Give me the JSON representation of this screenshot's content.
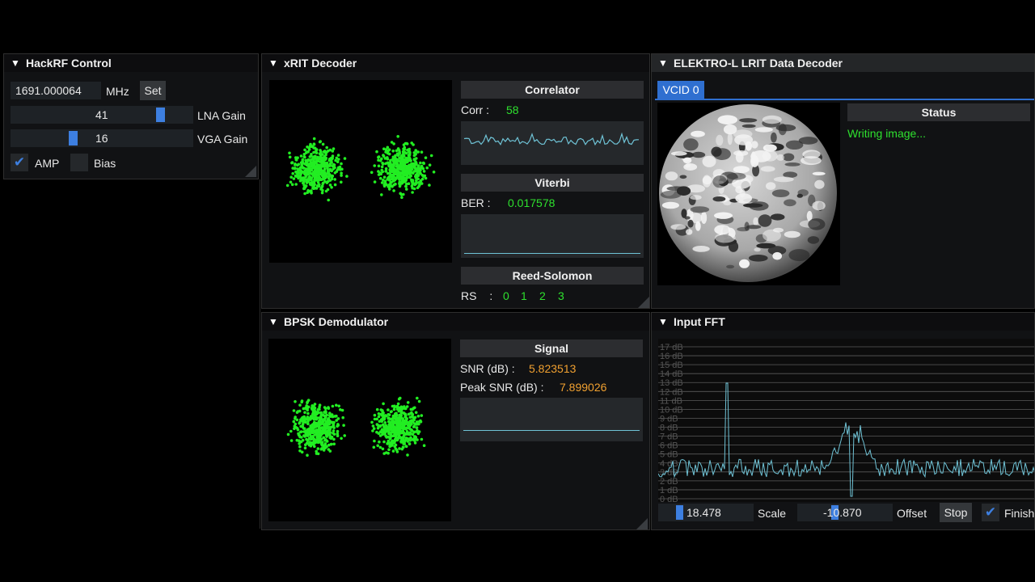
{
  "hackrf": {
    "title": "HackRF Control",
    "frequency": "1691.000064",
    "freq_unit": "MHz",
    "set_label": "Set",
    "lna_value": "41",
    "lna_label": "LNA Gain",
    "vga_value": "16",
    "vga_label": "VGA Gain",
    "amp_label": "AMP",
    "amp_checked": true,
    "bias_label": "Bias",
    "bias_checked": false
  },
  "xrit": {
    "title": "xRIT Decoder",
    "correlator_header": "Correlator",
    "corr_label": "Corr :",
    "corr_value": "58",
    "viterbi_header": "Viterbi",
    "ber_label": "BER :",
    "ber_value": "0.017578",
    "rs_header": "Reed-Solomon",
    "rs_label": "RS :",
    "rs_values": [
      "0",
      "1",
      "2",
      "3"
    ]
  },
  "elektro": {
    "title": "ELEKTRO-L LRIT Data Decoder",
    "tab": "VCID 0",
    "status_header": "Status",
    "status_text": "Writing image..."
  },
  "bpsk": {
    "title": "BPSK Demodulator",
    "signal_header": "Signal",
    "snr_label": "SNR (dB) :",
    "snr_value": "5.823513",
    "peak_label": "Peak SNR (dB) :",
    "peak_value": "7.899026"
  },
  "fft": {
    "title": "Input FFT",
    "db_labels": [
      "17 dB",
      "16 dB",
      "15 dB",
      "14 dB",
      "13 dB",
      "12 dB",
      "11 dB",
      "10 dB",
      "9 dB",
      "8 dB",
      "7 dB",
      "6 dB",
      "5 dB",
      "4 dB",
      "3 dB",
      "2 dB",
      "1 dB",
      "0 dB"
    ],
    "scale_value": "18.478",
    "scale_label": "Scale",
    "offset_value": "-10.870",
    "offset_label": "Offset",
    "stop_label": "Stop",
    "finish_label": "Finish",
    "finish_checked": true
  },
  "colors": {
    "constellation": "#22ee22",
    "trace": "#6fc3d6",
    "accent": "#3d7fe0",
    "good": "#2ee02e",
    "warn": "#f0a030"
  }
}
